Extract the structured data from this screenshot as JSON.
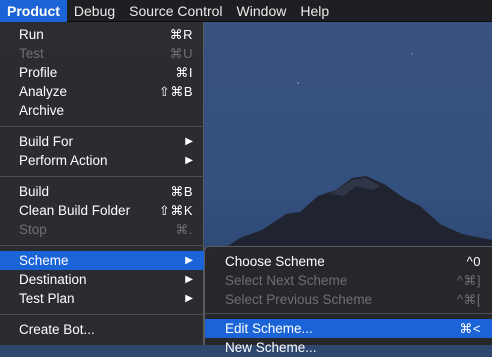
{
  "menubar": {
    "items": [
      "Product",
      "Debug",
      "Source Control",
      "Window",
      "Help"
    ]
  },
  "product_menu": {
    "items": [
      {
        "label": "Run",
        "shortcut": "⌘R"
      },
      {
        "label": "Test",
        "shortcut": "⌘U",
        "disabled": true
      },
      {
        "label": "Profile",
        "shortcut": "⌘I"
      },
      {
        "label": "Analyze",
        "shortcut": "⇧⌘B"
      },
      {
        "label": "Archive",
        "shortcut": ""
      },
      {
        "label": "Build For",
        "shortcut": "▶"
      },
      {
        "label": "Perform Action",
        "shortcut": "▶"
      },
      {
        "label": "Build",
        "shortcut": "⌘B"
      },
      {
        "label": "Clean Build Folder",
        "shortcut": "⇧⌘K"
      },
      {
        "label": "Stop",
        "shortcut": "⌘.",
        "disabled": true
      },
      {
        "label": "Scheme",
        "shortcut": "▶",
        "selected": true
      },
      {
        "label": "Destination",
        "shortcut": "▶"
      },
      {
        "label": "Test Plan",
        "shortcut": "▶"
      },
      {
        "label": "Create Bot...",
        "shortcut": ""
      }
    ]
  },
  "scheme_submenu": {
    "items": [
      {
        "label": "Choose Scheme",
        "shortcut": "^0"
      },
      {
        "label": "Select Next Scheme",
        "shortcut": "^⌘]",
        "disabled": true
      },
      {
        "label": "Select Previous Scheme",
        "shortcut": "^⌘[",
        "disabled": true
      },
      {
        "label": "Edit Scheme...",
        "shortcut": "⌘<",
        "selected": true
      },
      {
        "label": "New Scheme...",
        "shortcut": ""
      }
    ]
  },
  "colors": {
    "accent": "#1b64d8",
    "menu_bg": "#2b2b2e",
    "desktop_sky": "#2f466e",
    "mountain": "#1e2229"
  }
}
